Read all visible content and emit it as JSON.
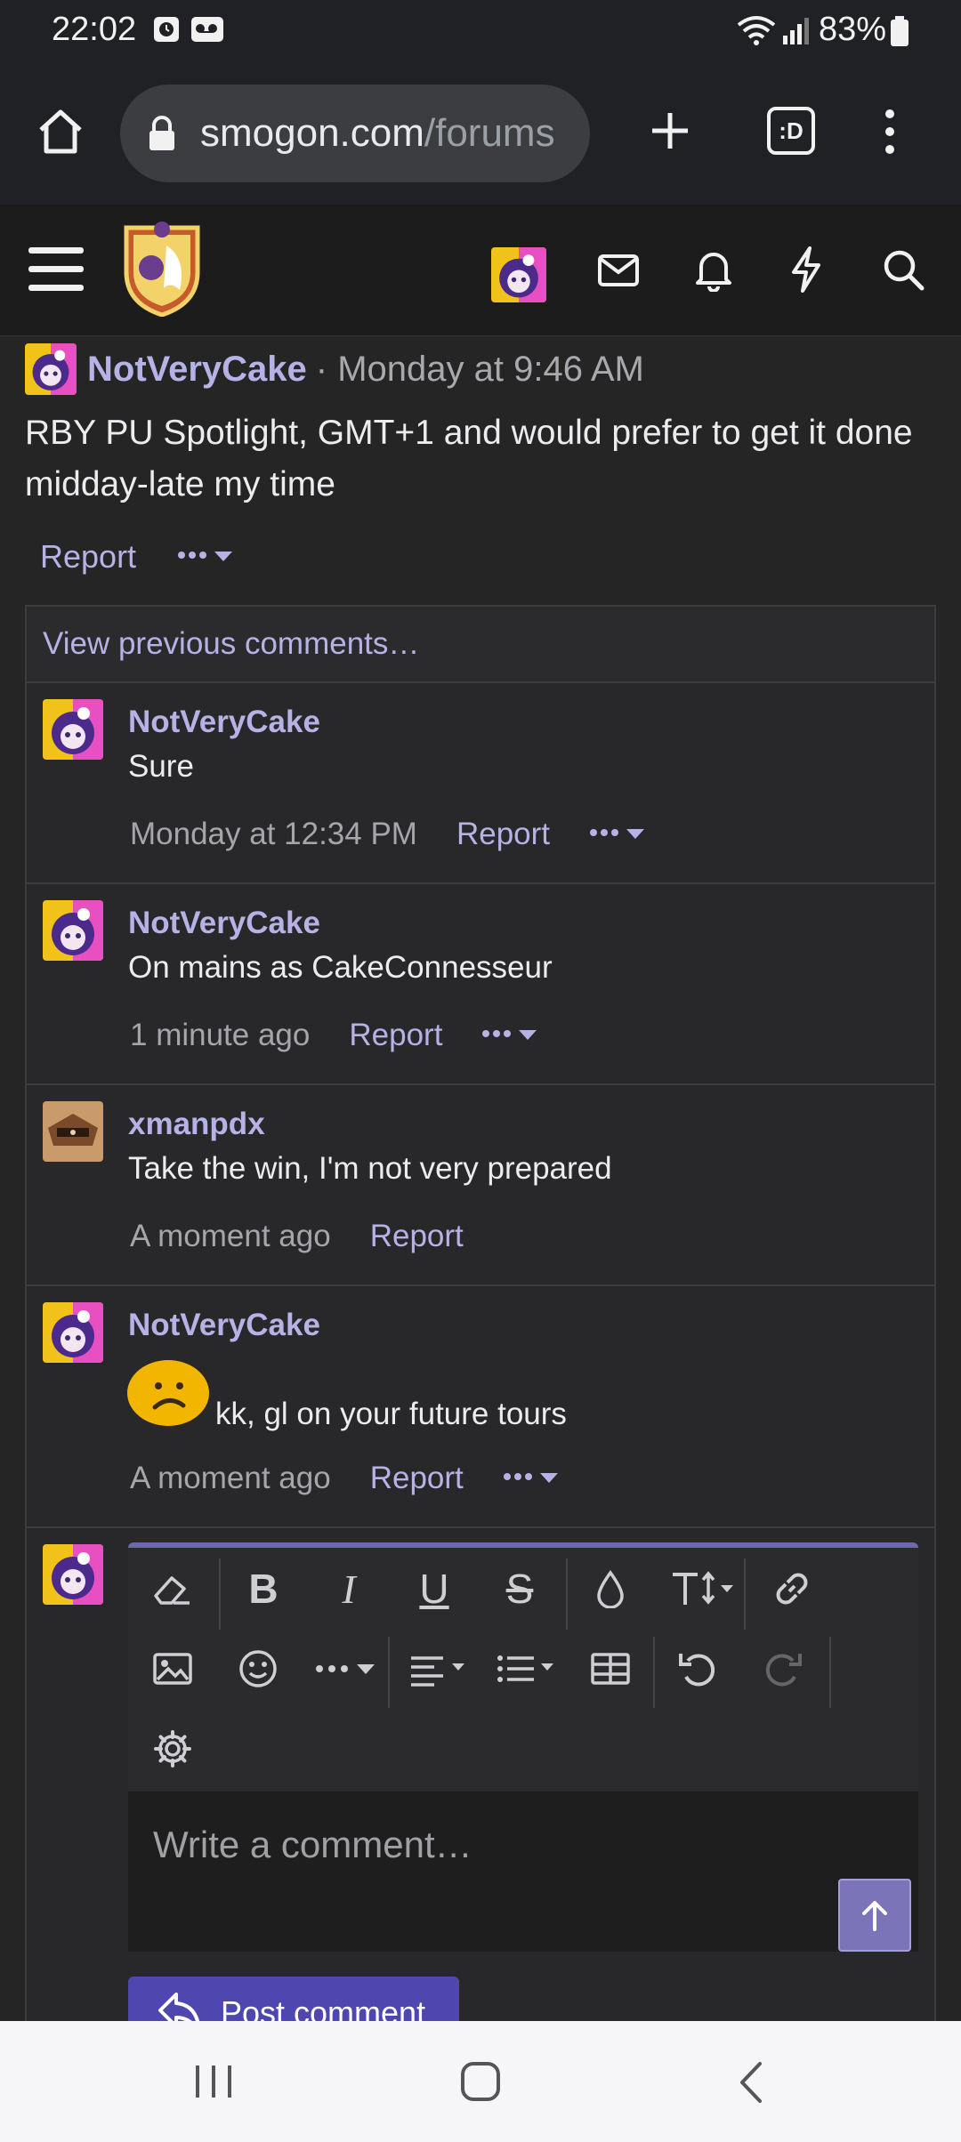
{
  "status_bar": {
    "time": "22:02",
    "battery": "83%"
  },
  "browser": {
    "url_host": "smogon.com",
    "url_path": "/forums",
    "tab_count": ":D"
  },
  "post": {
    "author": "NotVeryCake",
    "date": "· Monday at 9:46 AM",
    "body": "RBY PU Spotlight, GMT+1 and would prefer to get it done midday-late my time",
    "report_label": "Report"
  },
  "comments": {
    "view_previous": "View previous comments…",
    "items": [
      {
        "author": "NotVeryCake",
        "text": "Sure",
        "date": "Monday at 12:34 PM",
        "report": "Report"
      },
      {
        "author": "NotVeryCake",
        "text": "On mains as CakeConnesseur",
        "date": "1 minute ago",
        "report": "Report"
      },
      {
        "author": "xmanpdx",
        "text": "Take the win, I'm not very prepared",
        "date": "A moment ago",
        "report": "Report"
      },
      {
        "author": "NotVeryCake",
        "text": "kk, gl on your future tours",
        "date": "A moment ago",
        "report": "Report"
      }
    ]
  },
  "editor": {
    "placeholder": "Write a comment…",
    "post_button": "Post comment"
  },
  "colors": {
    "accent": "#b7b2e6",
    "button": "#4f47b0",
    "background": "#252526"
  }
}
